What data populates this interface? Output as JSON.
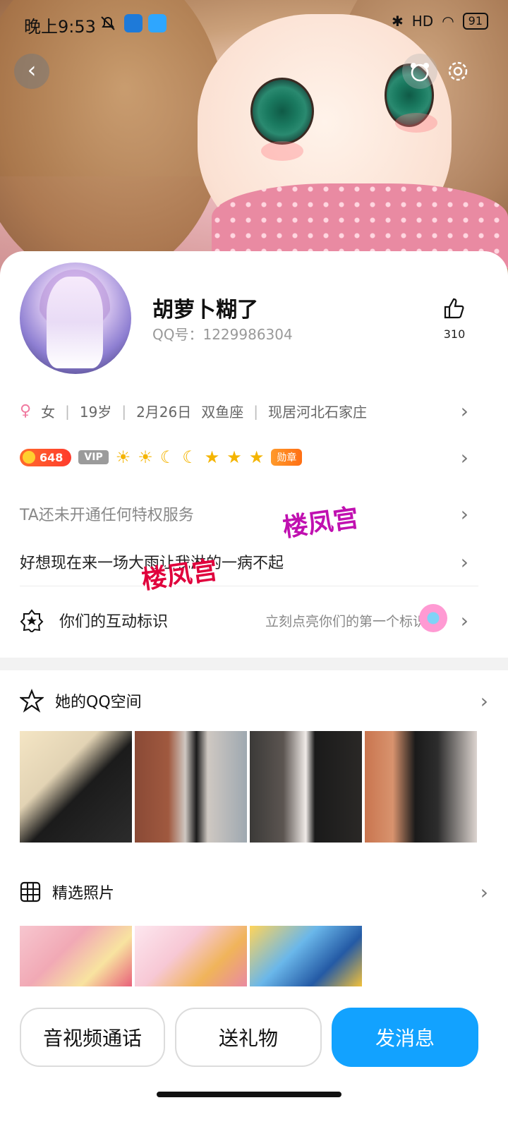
{
  "status_bar": {
    "time": "晚上9:53",
    "battery": "91",
    "network": "HD"
  },
  "profile": {
    "name": "胡萝卜糊了",
    "qq_number": "QQ号：1229986304",
    "likes": "310"
  },
  "info": {
    "gender": "女",
    "age": "19岁",
    "birthday": "2月26日",
    "zodiac": "双鱼座",
    "location": "现居河北石家庄"
  },
  "badges": {
    "coins": "648",
    "vip": "VIP",
    "medal": "勋章",
    "level_icons": [
      "sun-icon",
      "sun-icon",
      "moon-icon",
      "moon-icon",
      "star-icon",
      "star-icon",
      "star-icon"
    ]
  },
  "privilege": "TA还未开通任何特权服务",
  "signature": "好想现在来一场大雨让我淋的一病不起",
  "interaction": {
    "label": "你们的互动标识",
    "hint": "立刻点亮你们的第一个标识"
  },
  "qzone": {
    "title": "她的QQ空间"
  },
  "photos": {
    "title": "精选照片"
  },
  "watermark": "楼凤宫",
  "actions": {
    "call": "音视频通话",
    "gift": "送礼物",
    "message": "发消息"
  },
  "colors": {
    "primary": "#12a2ff",
    "coin": "#ff3b2d"
  }
}
